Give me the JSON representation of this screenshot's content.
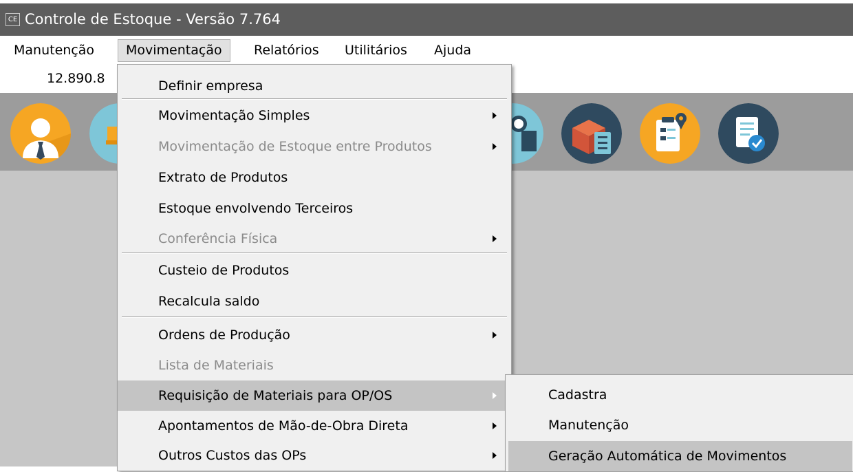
{
  "window": {
    "title": "Controle de Estoque - Versão 7.764",
    "icon_text": "CE"
  },
  "menubar": [
    {
      "label": "Manutenção"
    },
    {
      "label": "Movimentação"
    },
    {
      "label": "Relatórios"
    },
    {
      "label": "Utilitários"
    },
    {
      "label": "Ajuda"
    }
  ],
  "info": {
    "value": "12.890.8"
  },
  "toolbar": {
    "buttons": [
      {
        "icon": "user-icon"
      },
      {
        "icon": "truck-icon"
      },
      {
        "icon": "money-box-icon"
      },
      {
        "icon": "box-checklist-icon"
      },
      {
        "icon": "clipboard-location-icon"
      },
      {
        "icon": "document-check-icon"
      }
    ]
  },
  "dropdown": {
    "items": [
      {
        "label": "Definir empresa",
        "enabled": true,
        "submenu": false
      },
      {
        "label": "Movimentação Simples",
        "enabled": true,
        "submenu": true
      },
      {
        "label": "Movimentação de Estoque entre Produtos",
        "enabled": false,
        "submenu": true
      },
      {
        "label": "Extrato de Produtos",
        "enabled": true,
        "submenu": false
      },
      {
        "label": "Estoque envolvendo Terceiros",
        "enabled": true,
        "submenu": false
      },
      {
        "label": "Conferência Física",
        "enabled": false,
        "submenu": true
      },
      {
        "label": "Custeio de Produtos",
        "enabled": true,
        "submenu": false
      },
      {
        "label": "Recalcula saldo",
        "enabled": true,
        "submenu": false
      },
      {
        "label": "Ordens de Produção",
        "enabled": true,
        "submenu": true
      },
      {
        "label": "Lista de Materiais",
        "enabled": false,
        "submenu": false
      },
      {
        "label": "Requisição de Materiais para OP/OS",
        "enabled": true,
        "submenu": true,
        "highlighted": true
      },
      {
        "label": "Apontamentos de Mão-de-Obra Direta",
        "enabled": true,
        "submenu": true
      },
      {
        "label": "Outros Custos das OPs",
        "enabled": true,
        "submenu": true
      }
    ]
  },
  "submenu": {
    "items": [
      {
        "label": "Cadastra"
      },
      {
        "label": "Manutenção"
      },
      {
        "label": "Geração Automática de Movimentos",
        "highlighted": true
      }
    ]
  },
  "colors": {
    "titlebar": "#5d5d5d",
    "toolbar": "#9c9c9c",
    "workspace": "#c6c6c6",
    "highlight": "#c4c4c4"
  }
}
